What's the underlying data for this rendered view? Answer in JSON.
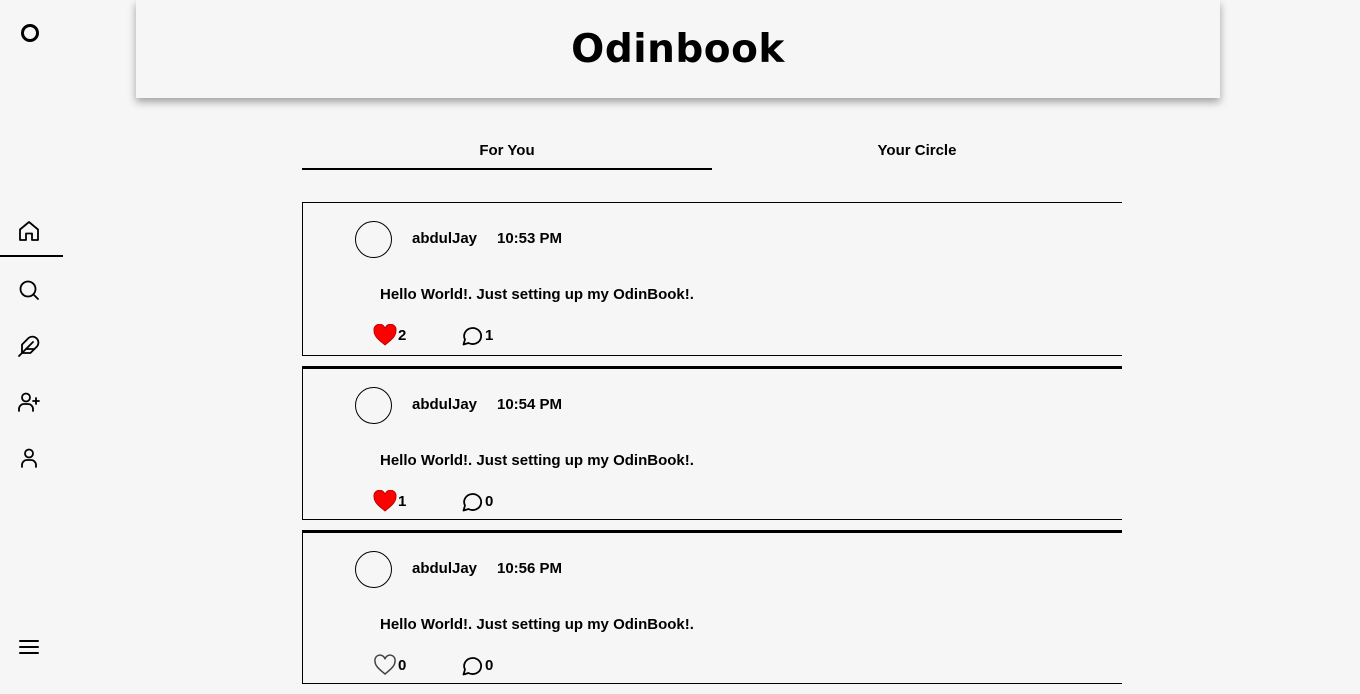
{
  "app": {
    "title": "Odinbook"
  },
  "sidebar": {
    "logo_icon": "circle-logo",
    "items": [
      {
        "name": "home",
        "icon": "home-icon",
        "active": true
      },
      {
        "name": "search",
        "icon": "search-icon",
        "active": false
      },
      {
        "name": "create-post",
        "icon": "feather-icon",
        "active": false
      },
      {
        "name": "add-friend",
        "icon": "user-plus-icon",
        "active": false
      },
      {
        "name": "profile",
        "icon": "user-icon",
        "active": false
      }
    ],
    "menu_icon": "hamburger-menu-icon"
  },
  "tabs": [
    {
      "label": "For You",
      "active": true
    },
    {
      "label": "Your Circle",
      "active": false
    }
  ],
  "posts": [
    {
      "username": "abdulJay",
      "time": "10:53 PM",
      "content": "Hello World!. Just setting up my OdinBook!.",
      "likes": "2",
      "liked": true,
      "comments": "1"
    },
    {
      "username": "abdulJay",
      "time": "10:54 PM",
      "content": "Hello World!. Just setting up my OdinBook!.",
      "likes": "1",
      "liked": true,
      "comments": "0"
    },
    {
      "username": "abdulJay",
      "time": "10:56 PM",
      "content": "Hello World!. Just setting up my OdinBook!.",
      "likes": "0",
      "liked": false,
      "comments": "0"
    }
  ],
  "colors": {
    "background": "#f6f6f6",
    "like_active": "#ff0000",
    "text": "#000000"
  }
}
